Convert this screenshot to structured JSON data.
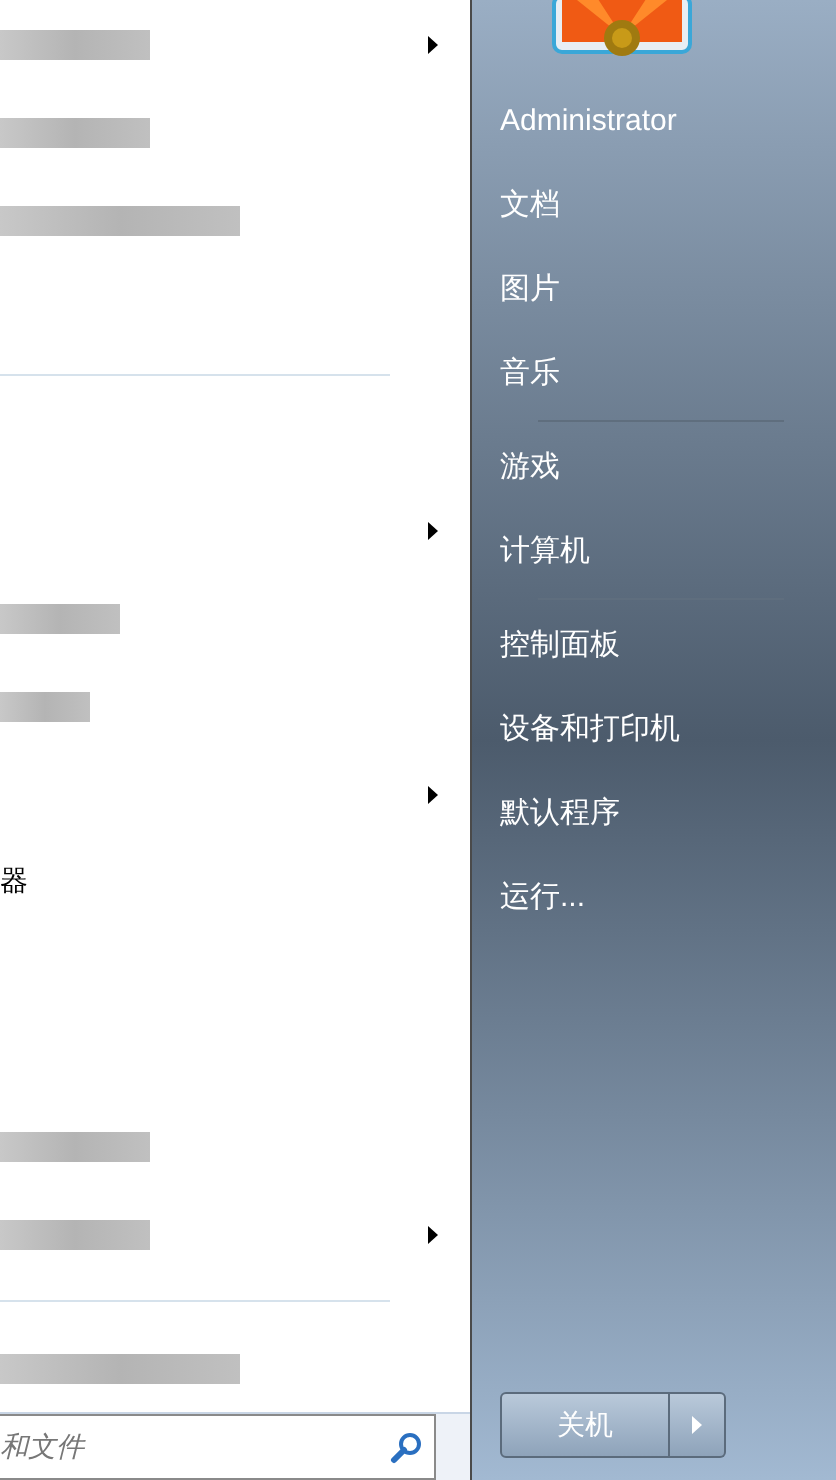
{
  "programs": [
    {
      "kind": "blurred",
      "submenu": true
    },
    {
      "kind": "blurred",
      "submenu": false
    },
    {
      "kind": "blurred",
      "submenu": false
    },
    {
      "kind": "blank",
      "submenu": false
    },
    {
      "kind": "separator"
    },
    {
      "kind": "blank",
      "submenu": false
    },
    {
      "kind": "blank",
      "submenu": true
    },
    {
      "kind": "blurred",
      "submenu": false
    },
    {
      "kind": "blurred",
      "submenu": false
    },
    {
      "kind": "blank",
      "submenu": true
    },
    {
      "kind": "text",
      "label": "器",
      "submenu": false
    },
    {
      "kind": "blank",
      "submenu": false
    },
    {
      "kind": "blank",
      "submenu": false
    },
    {
      "kind": "blurred",
      "submenu": false
    },
    {
      "kind": "blurred",
      "submenu": true
    },
    {
      "kind": "separator"
    },
    {
      "kind": "blurred",
      "submenu": false
    }
  ],
  "search": {
    "placeholder": "和文件"
  },
  "places": [
    {
      "kind": "link",
      "label": "Administrator"
    },
    {
      "kind": "link",
      "label": "文档"
    },
    {
      "kind": "link",
      "label": "图片"
    },
    {
      "kind": "link",
      "label": "音乐"
    },
    {
      "kind": "separator"
    },
    {
      "kind": "link",
      "label": "游戏"
    },
    {
      "kind": "link",
      "label": "计算机"
    },
    {
      "kind": "separator"
    },
    {
      "kind": "link",
      "label": "控制面板"
    },
    {
      "kind": "link",
      "label": "设备和打印机"
    },
    {
      "kind": "link",
      "label": "默认程序"
    },
    {
      "kind": "link",
      "label": "运行..."
    }
  ],
  "shutdown": {
    "label": "关机"
  }
}
